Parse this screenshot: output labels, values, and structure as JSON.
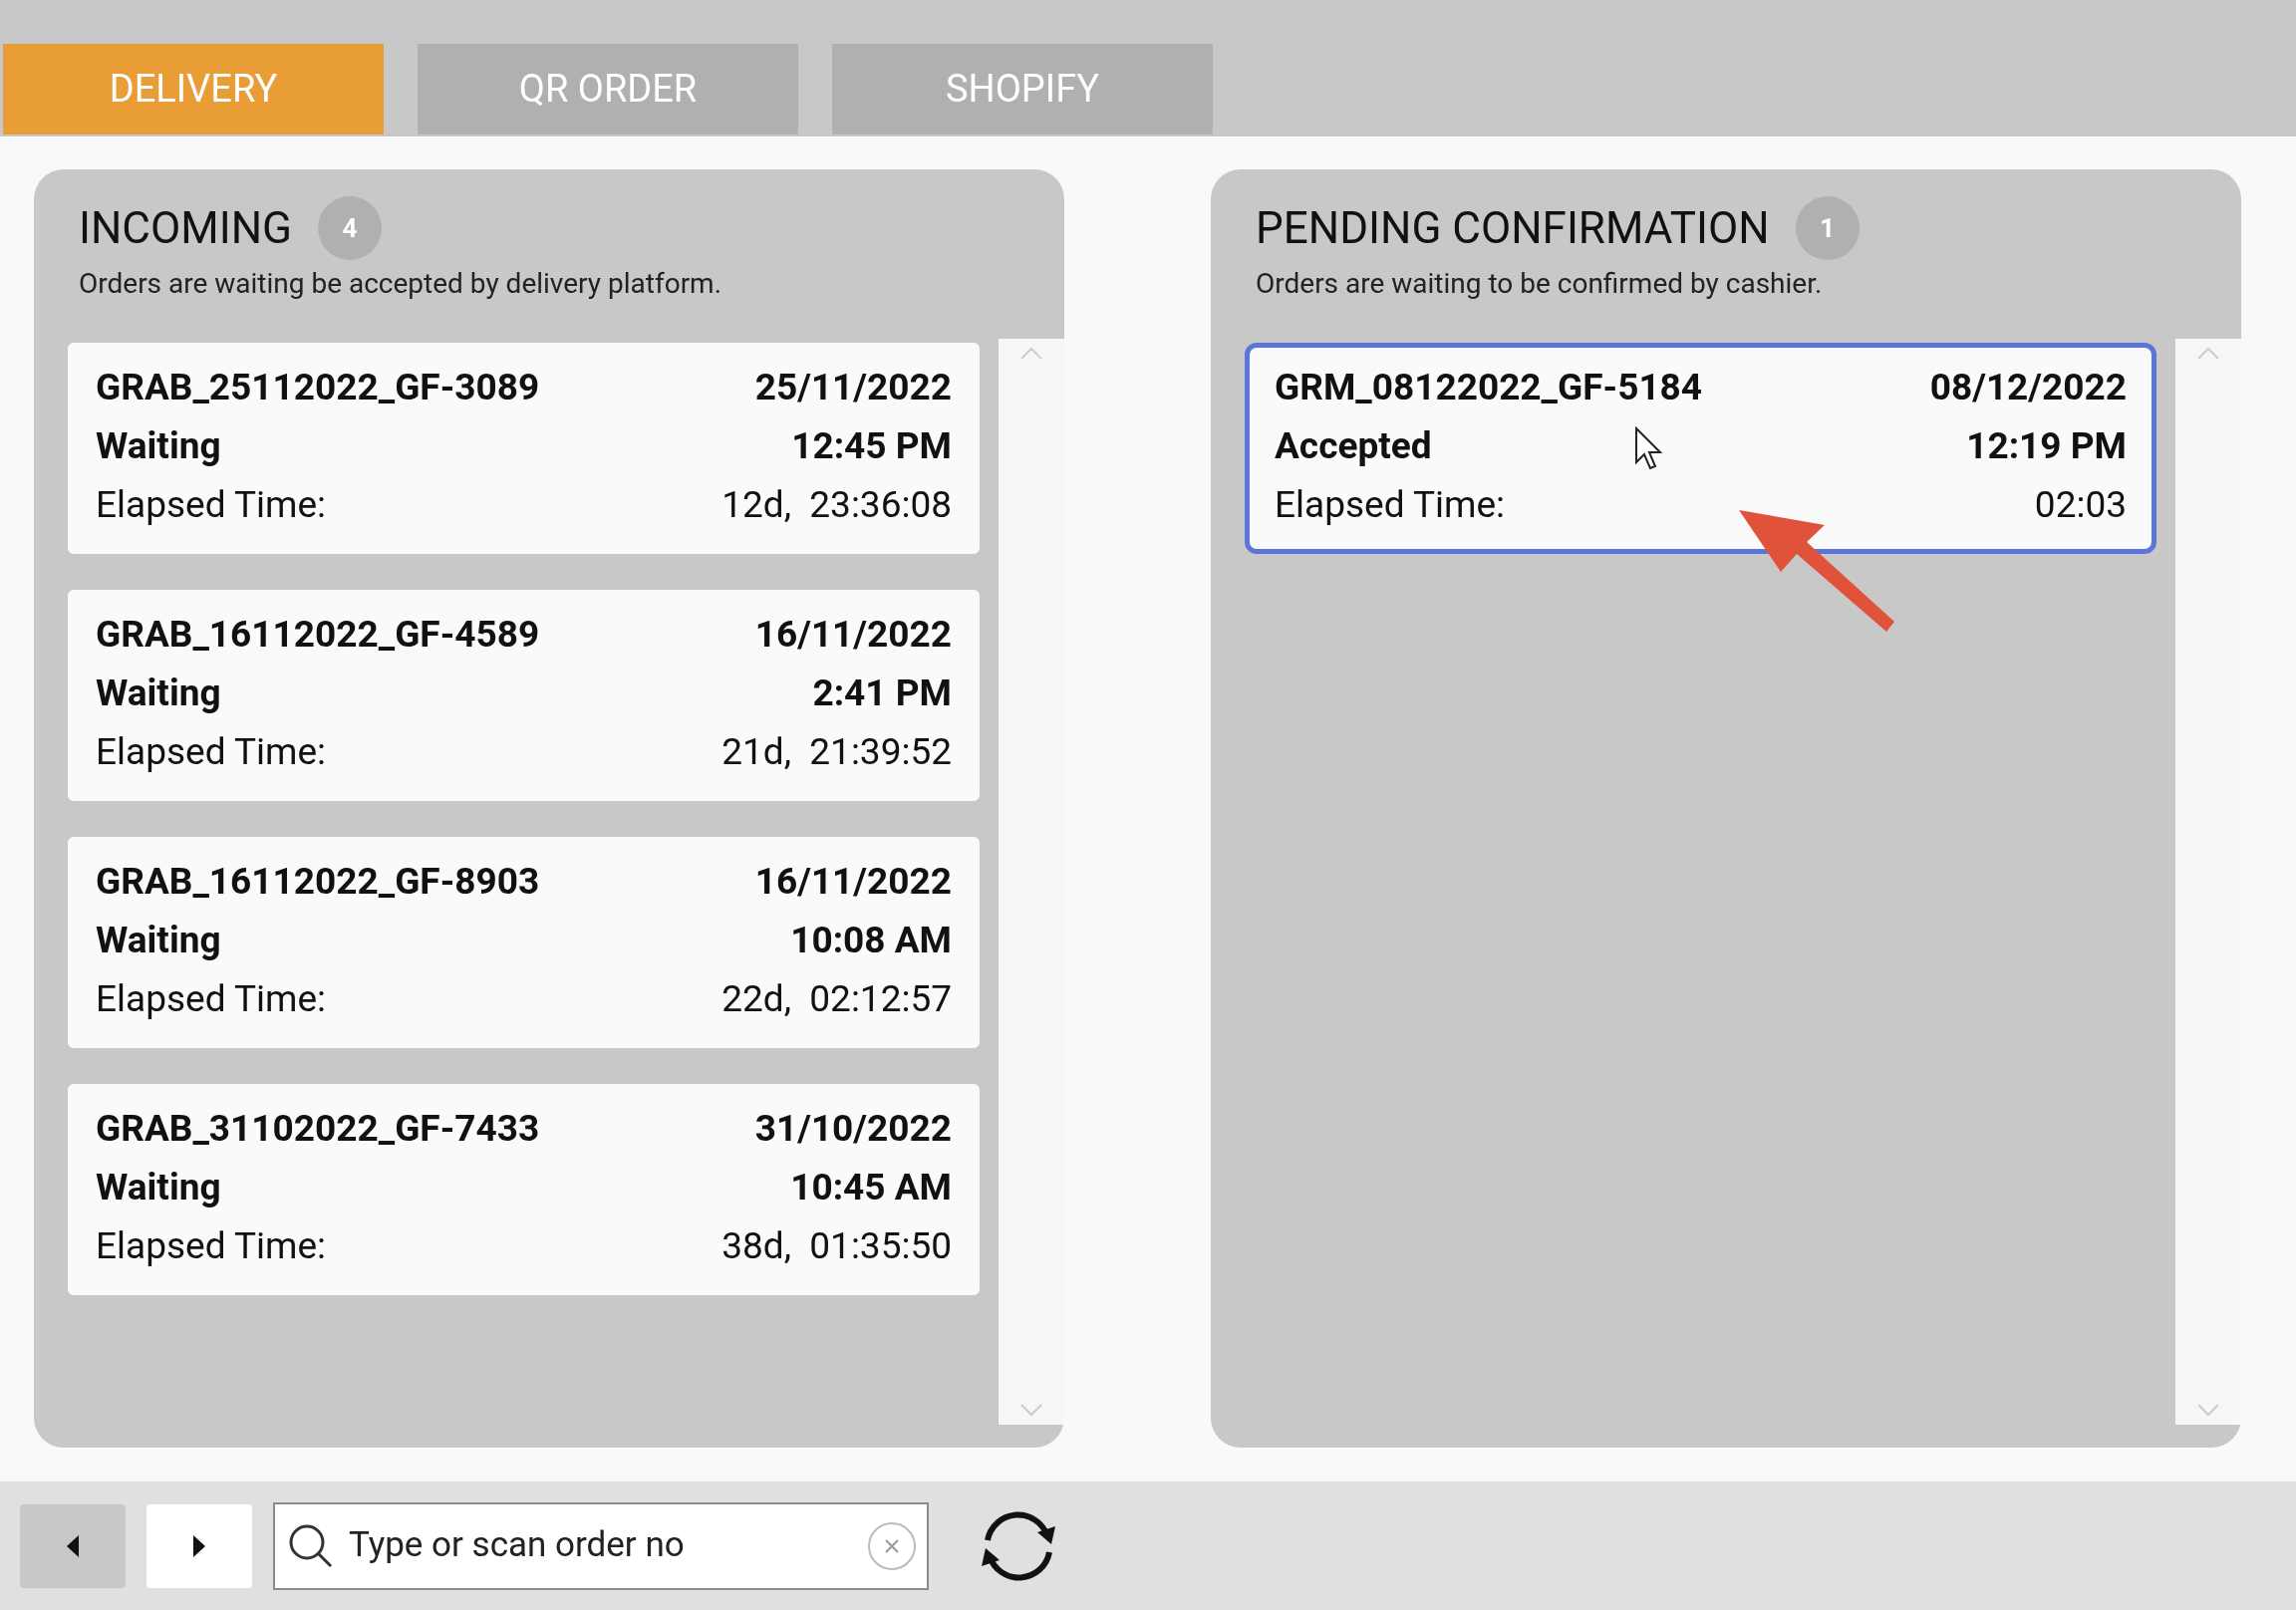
{
  "tabs": [
    {
      "label": "DELIVERY",
      "selected": true
    },
    {
      "label": "QR ORDER",
      "selected": false
    },
    {
      "label": "SHOPIFY",
      "selected": false
    }
  ],
  "panels": [
    {
      "title": "INCOMING",
      "count": "4",
      "subtitle": "Orders are waiting be accepted by delivery platform.",
      "orders": [
        {
          "id": "GRAB_25112022_GF-3089",
          "date": "25/11/2022",
          "status": "Waiting",
          "time": "12:45 PM",
          "elapsed_label": "Elapsed Time:",
          "elapsed": "12d,  23:36:08",
          "selected": false
        },
        {
          "id": "GRAB_16112022_GF-4589",
          "date": "16/11/2022",
          "status": "Waiting",
          "time": "2:41 PM",
          "elapsed_label": "Elapsed Time:",
          "elapsed": "21d,  21:39:52",
          "selected": false
        },
        {
          "id": "GRAB_16112022_GF-8903",
          "date": "16/11/2022",
          "status": "Waiting",
          "time": "10:08 AM",
          "elapsed_label": "Elapsed Time:",
          "elapsed": "22d,  02:12:57",
          "selected": false
        },
        {
          "id": "GRAB_31102022_GF-7433",
          "date": "31/10/2022",
          "status": "Waiting",
          "time": "10:45 AM",
          "elapsed_label": "Elapsed Time:",
          "elapsed": "38d,  01:35:50",
          "selected": false
        }
      ]
    },
    {
      "title": "PENDING CONFIRMATION",
      "count": "1",
      "subtitle": "Orders are waiting to be confirmed by cashier.",
      "orders": [
        {
          "id": "GRM_08122022_GF-5184",
          "date": "08/12/2022",
          "status": "Accepted",
          "time": "12:19 PM",
          "elapsed_label": "Elapsed Time:",
          "elapsed": "02:03",
          "selected": true
        }
      ]
    }
  ],
  "search": {
    "placeholder": "Type or scan order no"
  }
}
